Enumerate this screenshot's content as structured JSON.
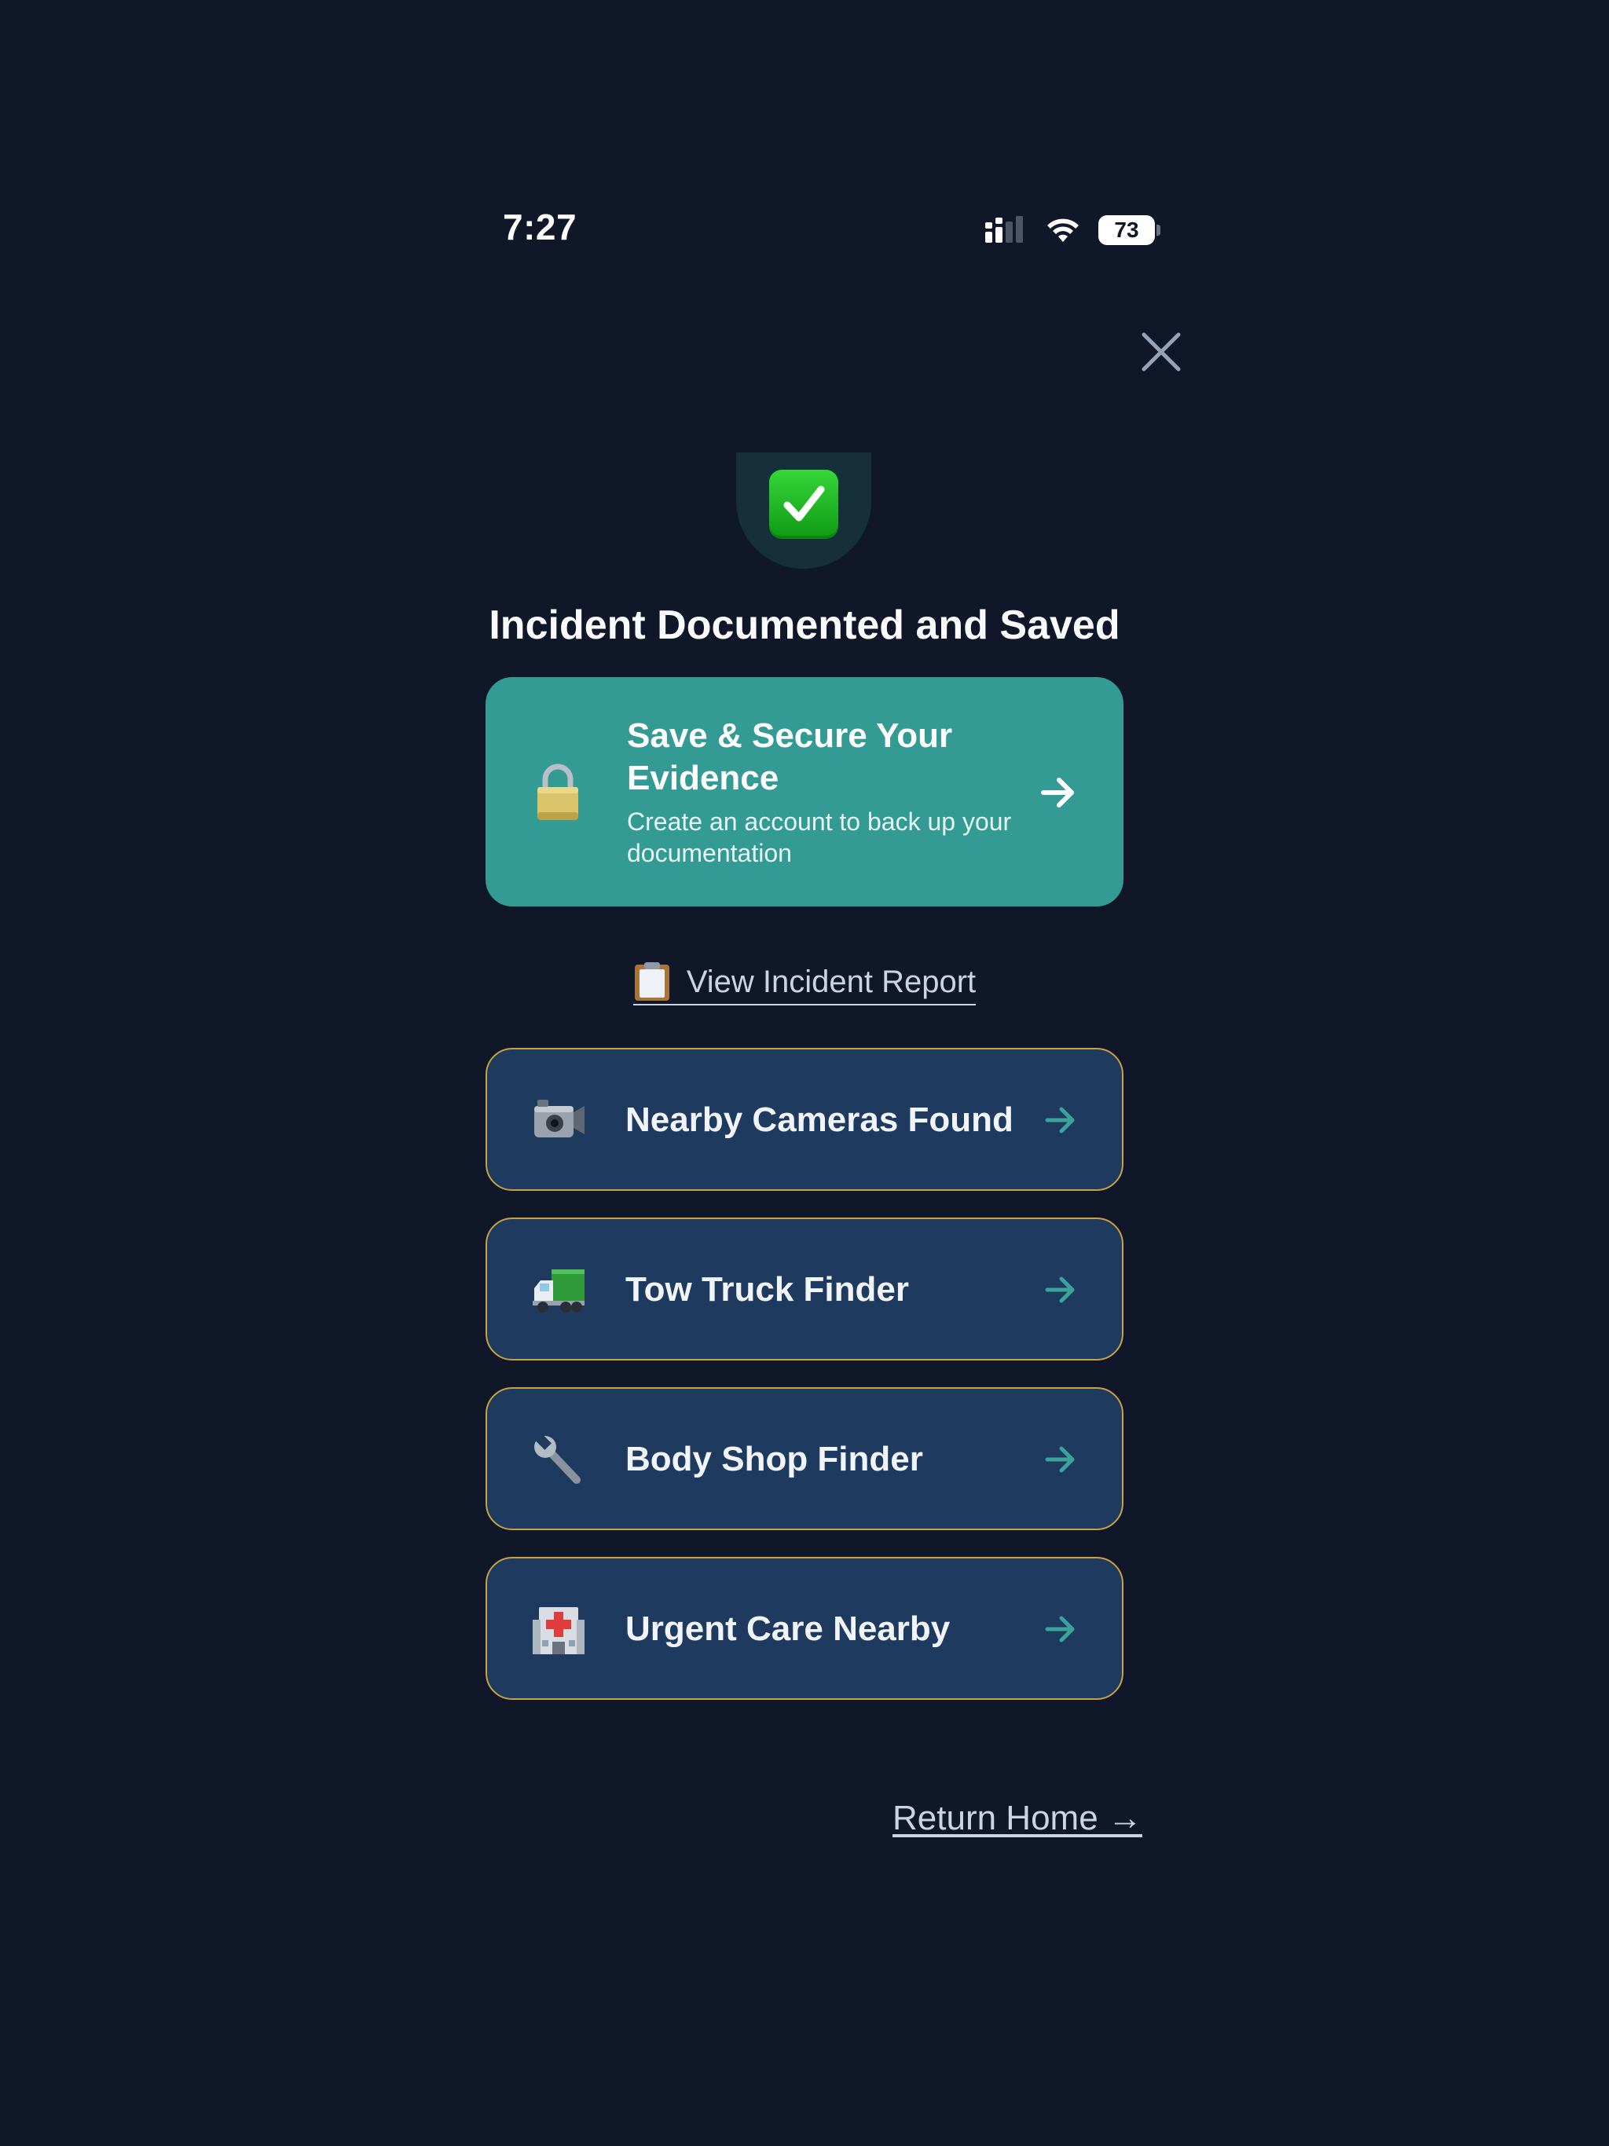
{
  "status_bar": {
    "time": "7:27",
    "signal_icon": "cellular-signal-icon",
    "wifi_icon": "wifi-icon",
    "battery_level": "73"
  },
  "close_icon": "close-icon",
  "success_icon": "check-mark-button-icon",
  "title": "Incident Documented and Saved",
  "cta": {
    "icon": "lock-icon",
    "title": "Save & Secure Your Evidence",
    "subtitle": "Create an account to back up your documentation",
    "color": "#349a94"
  },
  "report_link": {
    "icon": "clipboard-icon",
    "label": "View Incident Report"
  },
  "actions": [
    {
      "icon": "video-camera-icon",
      "label": "Nearby Cameras Found"
    },
    {
      "icon": "delivery-truck-icon",
      "label": "Tow Truck Finder"
    },
    {
      "icon": "wrench-icon",
      "label": "Body Shop Finder"
    },
    {
      "icon": "hospital-icon",
      "label": "Urgent Care Nearby"
    }
  ],
  "return_home": "Return Home →",
  "colors": {
    "background": "#0f1729",
    "card": "#1f3a5f",
    "card_border": "#c9a340",
    "accent": "#349a94",
    "arrow": "#3aa39c"
  }
}
